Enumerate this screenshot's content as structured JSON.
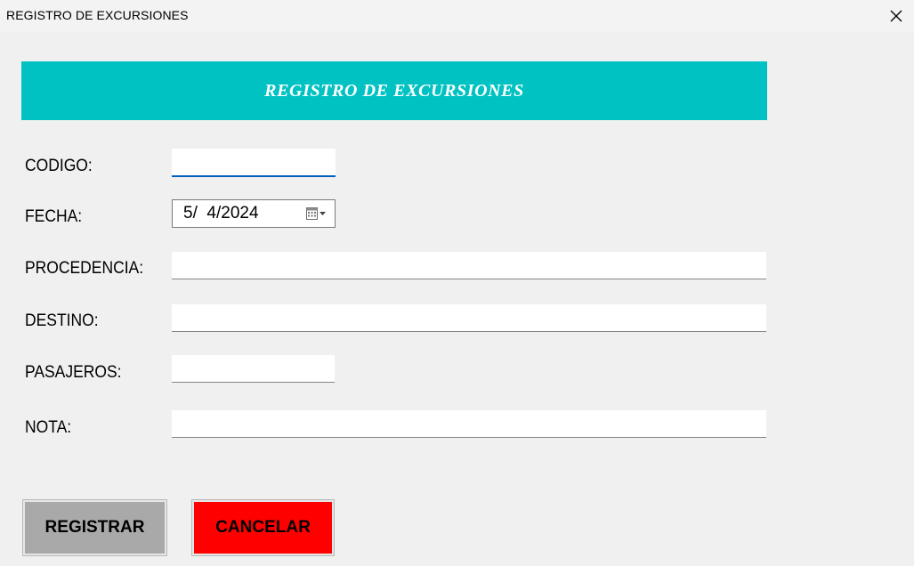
{
  "window": {
    "title": "REGISTRO DE EXCURSIONES",
    "close_icon": "close-icon"
  },
  "banner": {
    "title": "REGISTRO DE EXCURSIONES",
    "background": "#00c2c2",
    "text_color": "#ffffff"
  },
  "form": {
    "codigo": {
      "label": "CODIGO:",
      "value": ""
    },
    "fecha": {
      "label": "FECHA:",
      "value": "5/  4/2024",
      "icon": "calendar-dropdown-icon"
    },
    "procedencia": {
      "label": "PROCEDENCIA:",
      "value": ""
    },
    "destino": {
      "label": "DESTINO:",
      "value": ""
    },
    "pasajeros": {
      "label": "PASAJEROS:",
      "value": ""
    },
    "nota": {
      "label": "NOTA:",
      "value": ""
    }
  },
  "buttons": {
    "registrar": {
      "label": "REGISTRAR",
      "color": "#a9a9a9"
    },
    "cancelar": {
      "label": "CANCELAR",
      "color": "#ff0000"
    }
  }
}
